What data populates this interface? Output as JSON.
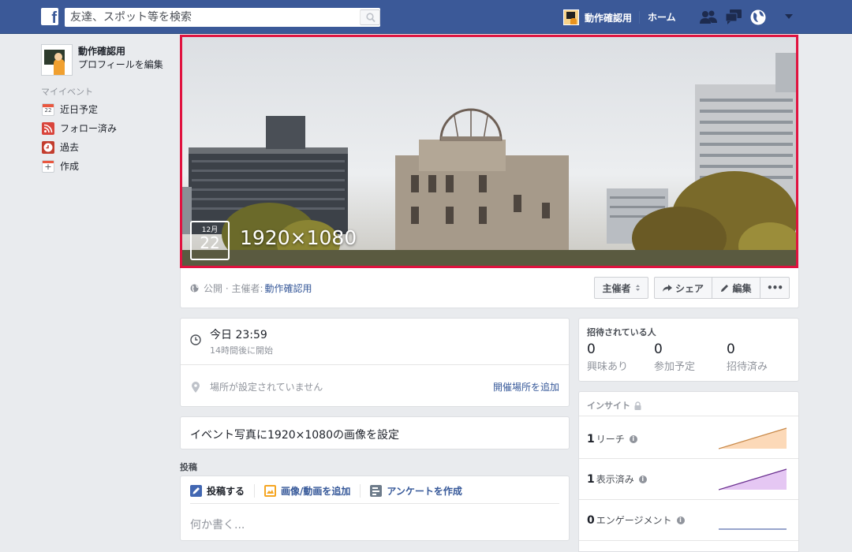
{
  "topbar": {
    "search_placeholder": "友達、スポット等を検索",
    "user_name": "動作確認用",
    "home": "ホーム",
    "icons": [
      "friend-requests-icon",
      "messages-icon",
      "notifications-globe-icon",
      "account-menu-icon"
    ]
  },
  "sidebar": {
    "profile_name": "動作確認用",
    "edit_profile": "プロフィールを編集",
    "section_title": "マイイベント",
    "items": [
      {
        "label": "近日予定",
        "icon": "calendar-icon",
        "badge": "22"
      },
      {
        "label": "フォロー済み",
        "icon": "rss-icon"
      },
      {
        "label": "過去",
        "icon": "clock-icon"
      },
      {
        "label": "作成",
        "icon": "plus-calendar-icon"
      }
    ]
  },
  "event": {
    "month": "12月",
    "day": "22",
    "title": "1920×1080",
    "privacy": "公開 · 主催者:",
    "host": "動作確認用",
    "host_button": "主催者",
    "share_button": "シェア",
    "edit_button": "編集",
    "more_button": "•••",
    "time_main": "今日 23:59",
    "time_sub": "14時間後に開始",
    "location": "場所が設定されていません",
    "add_location": "開催場所を追加",
    "photo_prompt": "イベント写真に1920×1080の画像を設定"
  },
  "posts": {
    "heading": "投稿",
    "tabs": [
      "投稿する",
      "画像/動画を追加",
      "アンケートを作成"
    ],
    "placeholder": "何か書く..."
  },
  "invited": {
    "heading": "招待されている人",
    "stats": [
      {
        "value": "0",
        "label": "興味あり"
      },
      {
        "value": "0",
        "label": "参加予定"
      },
      {
        "value": "0",
        "label": "招待済み"
      }
    ]
  },
  "insights": {
    "heading": "インサイト",
    "rows": [
      {
        "value": "1",
        "label": "リーチ",
        "color": "#f0a860",
        "fill": "#fcd9b8"
      },
      {
        "value": "1",
        "label": "表示済み",
        "color": "#7b3fa0",
        "fill": "#e5c7f3"
      },
      {
        "value": "0",
        "label": "エンゲージメント",
        "color": "#5b6fae",
        "fill": "none"
      }
    ]
  }
}
